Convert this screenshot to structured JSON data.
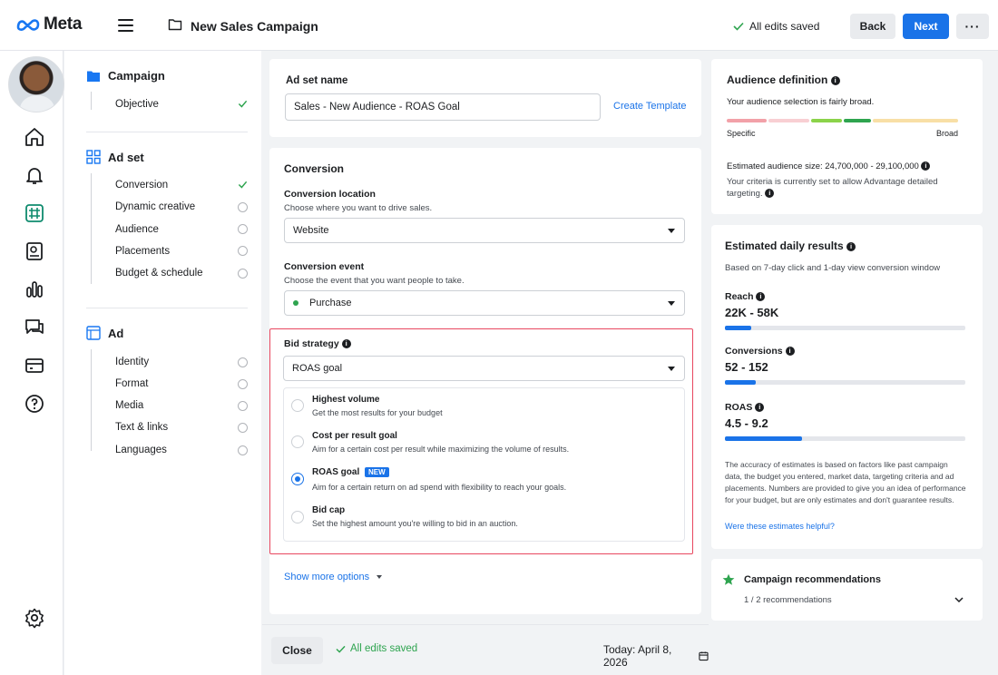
{
  "header": {
    "logo": "Meta",
    "campaign_name": "New Sales Campaign",
    "save_status": "All edits saved",
    "back_label": "Back",
    "next_label": "Next",
    "more_label": "···"
  },
  "nav": {
    "campaign": {
      "title": "Campaign",
      "items": [
        {
          "label": "Objective",
          "status": "done"
        }
      ]
    },
    "adset": {
      "title": "Ad set",
      "items": [
        {
          "label": "Conversion",
          "status": "done"
        },
        {
          "label": "Dynamic creative",
          "status": "empty"
        },
        {
          "label": "Audience",
          "status": "empty"
        },
        {
          "label": "Placements",
          "status": "empty"
        },
        {
          "label": "Budget & schedule",
          "status": "empty"
        }
      ]
    },
    "ad": {
      "title": "Ad",
      "items": [
        {
          "label": "Identity",
          "status": "empty"
        },
        {
          "label": "Format",
          "status": "empty"
        },
        {
          "label": "Media",
          "status": "empty"
        },
        {
          "label": "Text & links",
          "status": "empty"
        },
        {
          "label": "Languages",
          "status": "empty"
        }
      ]
    }
  },
  "adset_name": {
    "label": "Ad set name",
    "value": "Sales - New Audience - ROAS Goal",
    "create_template": "Create Template"
  },
  "conversion": {
    "title": "Conversion",
    "location_label": "Conversion location",
    "location_help": "Choose where you want to drive sales.",
    "location_value": "Website",
    "event_label": "Conversion event",
    "event_help": "Choose the event that you want people to take.",
    "event_value": "Purchase",
    "bid_label": "Bid strategy",
    "bid_value": "ROAS goal",
    "options": [
      {
        "title": "Highest volume",
        "desc": "Get the most results for your budget",
        "selected": false
      },
      {
        "title": "Cost per result goal",
        "desc": "Aim for a certain cost per result while maximizing the volume of results.",
        "selected": false
      },
      {
        "title": "ROAS goal",
        "desc": "Aim for a certain return on ad spend with flexibility to reach your goals.",
        "selected": true,
        "badge": "NEW"
      },
      {
        "title": "Bid cap",
        "desc": "Set the highest amount you're willing to bid in an auction.",
        "selected": false
      }
    ],
    "show_more": "Show more options"
  },
  "footer": {
    "close_label": "Close",
    "save_status": "All edits saved",
    "today": "Today: April 8, 2026"
  },
  "audience": {
    "title": "Audience definition",
    "summary": "Your audience selection is fairly broad.",
    "specific_label": "Specific",
    "broad_label": "Broad",
    "size_text": "Estimated audience size: 24,700,000 - 29,100,000",
    "criteria_line1": "Your criteria is currently set to allow Advantage detailed",
    "criteria_line2": "targeting."
  },
  "estimates": {
    "title": "Estimated daily results",
    "window": "Based on 7-day click and 1-day view conversion window",
    "metrics": [
      {
        "label": "Reach",
        "value": "22K - 58K",
        "fill": 0.11
      },
      {
        "label": "Conversions",
        "value": "52 - 152",
        "fill": 0.13
      },
      {
        "label": "ROAS",
        "value": "4.5 - 9.2",
        "fill": 0.32
      }
    ],
    "disclaimer_lines": [
      "The accuracy of estimates is based on factors like past campaign",
      "data, the budget you entered, market data, targeting criteria and ad",
      "placements. Numbers are provided to give you an idea of performance",
      "for your budget, but are only estimates and don't guarantee results."
    ],
    "feedback_link": "Were these estimates helpful?"
  },
  "recommendations": {
    "title": "Campaign recommendations",
    "count": "1 / 2 recommendations"
  },
  "colors": {
    "accent": "#1a73e8",
    "success": "#2ea44f",
    "highlight_border": "#e8475f"
  }
}
